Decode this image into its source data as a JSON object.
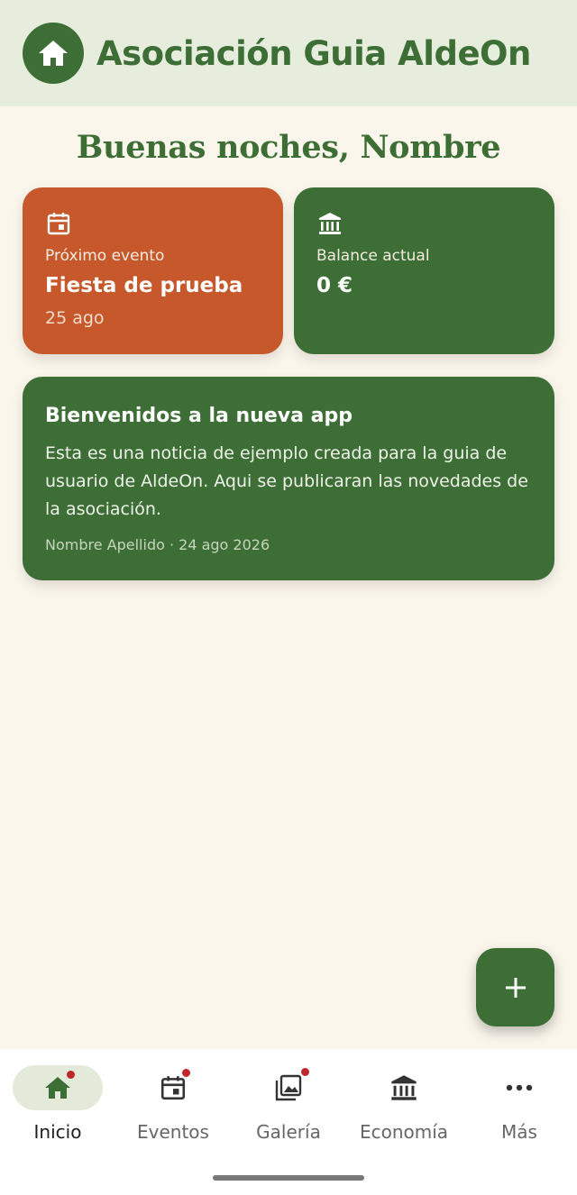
{
  "header": {
    "title": "Asociación Guia AldeOn",
    "logo_icon": "home-icon"
  },
  "greeting": "Buenas noches, Nombre",
  "cards": {
    "event": {
      "icon": "calendar-icon",
      "label": "Próximo evento",
      "value": "Fiesta de prueba",
      "date": "25 ago",
      "color": "#c6582b"
    },
    "balance": {
      "icon": "bank-icon",
      "label": "Balance actual",
      "value": "0 €",
      "color": "#3d6e35"
    }
  },
  "news": {
    "title": "Bienvenidos a la nueva app",
    "body": "Esta es una noticia de ejemplo creada para la guia de usuario de AldeOn. Aqui se publicaran las novedades de la asociación.",
    "meta": "Nombre Apellido · 24 ago 2026"
  },
  "fab": {
    "icon": "plus-icon"
  },
  "nav": {
    "items": [
      {
        "label": "Inicio",
        "icon": "home-icon",
        "active": true,
        "badge": true
      },
      {
        "label": "Eventos",
        "icon": "calendar-icon",
        "active": false,
        "badge": true
      },
      {
        "label": "Galería",
        "icon": "gallery-icon",
        "active": false,
        "badge": true
      },
      {
        "label": "Economía",
        "icon": "bank-icon",
        "active": false,
        "badge": false
      },
      {
        "label": "Más",
        "icon": "more-icon",
        "active": false,
        "badge": false
      }
    ]
  },
  "colors": {
    "primary": "#3d6e35",
    "accent": "#c6582b",
    "background": "#fbf6ec",
    "header_bg": "#e6eddd",
    "badge": "#c0272d"
  }
}
